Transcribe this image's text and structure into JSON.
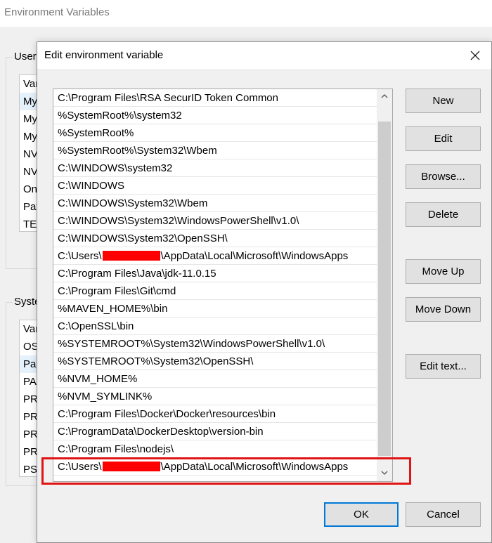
{
  "background_window": {
    "title": "Environment Variables",
    "user_group_label": "User",
    "user_list": [
      "Vari",
      "My",
      "My",
      "My",
      "NV",
      "NV",
      "On",
      "Pat",
      "TEI"
    ],
    "system_group_label": "Syste",
    "system_list": [
      "Vari",
      "OS",
      "Pat",
      "PA",
      "PR",
      "PR",
      "PR",
      "PR",
      "PS"
    ]
  },
  "dialog": {
    "title": "Edit environment variable",
    "close_icon": "close-icon",
    "paths": [
      {
        "pre": "C:\\Program Files\\RSA SecurID Token Common"
      },
      {
        "pre": "%SystemRoot%\\system32"
      },
      {
        "pre": "%SystemRoot%"
      },
      {
        "pre": "%SystemRoot%\\System32\\Wbem"
      },
      {
        "pre": "C:\\WINDOWS\\system32"
      },
      {
        "pre": "C:\\WINDOWS"
      },
      {
        "pre": "C:\\WINDOWS\\System32\\Wbem"
      },
      {
        "pre": "C:\\WINDOWS\\System32\\WindowsPowerShell\\v1.0\\"
      },
      {
        "pre": "C:\\WINDOWS\\System32\\OpenSSH\\"
      },
      {
        "pre": "C:\\Users\\",
        "post": "\\AppData\\Local\\Microsoft\\WindowsApps"
      },
      {
        "pre": "C:\\Program Files\\Java\\jdk-11.0.15"
      },
      {
        "pre": "C:\\Program Files\\Git\\cmd"
      },
      {
        "pre": "%MAVEN_HOME%\\bin"
      },
      {
        "pre": "C:\\OpenSSL\\bin"
      },
      {
        "pre": "%SYSTEMROOT%\\System32\\WindowsPowerShell\\v1.0\\"
      },
      {
        "pre": "%SYSTEMROOT%\\System32\\OpenSSH\\"
      },
      {
        "pre": "%NVM_HOME%"
      },
      {
        "pre": "%NVM_SYMLINK%"
      },
      {
        "pre": "C:\\Program Files\\Docker\\Docker\\resources\\bin"
      },
      {
        "pre": "C:\\ProgramData\\DockerDesktop\\version-bin"
      },
      {
        "pre": "C:\\Program Files\\nodejs\\"
      },
      {
        "pre": "C:\\Users\\",
        "post": "\\AppData\\Local\\Microsoft\\WindowsApps"
      }
    ],
    "buttons": {
      "new": "New",
      "edit": "Edit",
      "browse": "Browse...",
      "delete": "Delete",
      "move_up": "Move Up",
      "move_down": "Move Down",
      "edit_text": "Edit text...",
      "ok": "OK",
      "cancel": "Cancel"
    },
    "colors": {
      "highlight": "#e01414",
      "redaction": "#ff0000",
      "default_button_border": "#0078d7"
    }
  }
}
